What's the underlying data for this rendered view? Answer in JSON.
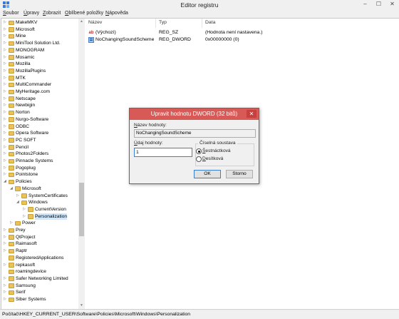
{
  "window": {
    "title": "Editor registru",
    "minimize": "–",
    "maximize": "☐",
    "close": "✕"
  },
  "menu": [
    {
      "accel": "S",
      "rest": "oubor"
    },
    {
      "accel": "Ú",
      "rest": "pravy"
    },
    {
      "accel": "Z",
      "rest": "obrazit"
    },
    {
      "accel": "O",
      "rest": "blíbené položky"
    },
    {
      "accel": "N",
      "rest": "ápověda"
    }
  ],
  "tree": [
    {
      "label": "MakeMKV",
      "level": 0,
      "expanded": false
    },
    {
      "label": "Microsoft",
      "level": 0,
      "expanded": false
    },
    {
      "label": "Mine",
      "level": 0,
      "expanded": false
    },
    {
      "label": "MiniTool Solution Ltd.",
      "level": 0,
      "expanded": false
    },
    {
      "label": "MONOGRAM",
      "level": 0,
      "expanded": false
    },
    {
      "label": "Mosamic",
      "level": 0,
      "expanded": false
    },
    {
      "label": "Mozilla",
      "level": 0,
      "expanded": false
    },
    {
      "label": "MozillaPlugins",
      "level": 0,
      "expanded": false
    },
    {
      "label": "MTK",
      "level": 0,
      "expanded": false
    },
    {
      "label": "MultiCommander",
      "level": 0,
      "expanded": false
    },
    {
      "label": "MyHeritage.com",
      "level": 0,
      "expanded": false
    },
    {
      "label": "Netscape",
      "level": 0,
      "expanded": false
    },
    {
      "label": "Newbigin",
      "level": 0,
      "expanded": false
    },
    {
      "label": "Norton",
      "level": 0,
      "expanded": false
    },
    {
      "label": "Nurgo-Software",
      "level": 0,
      "expanded": false
    },
    {
      "label": "ODBC",
      "level": 0,
      "expanded": false
    },
    {
      "label": "Opera Software",
      "level": 0,
      "expanded": false
    },
    {
      "label": "PC SOFT",
      "level": 0,
      "expanded": false
    },
    {
      "label": "Pencil",
      "level": 0,
      "expanded": false
    },
    {
      "label": "Photos2Folders",
      "level": 0,
      "expanded": false
    },
    {
      "label": "Pinnacle Systems",
      "level": 0,
      "expanded": false
    },
    {
      "label": "Pogoplug",
      "level": 0,
      "expanded": false
    },
    {
      "label": "Pointstone",
      "level": 0,
      "expanded": false
    },
    {
      "label": "Policies",
      "level": 0,
      "expanded": true
    },
    {
      "label": "Microsoft",
      "level": 1,
      "expanded": true
    },
    {
      "label": "SystemCertificates",
      "level": 2,
      "expanded": false
    },
    {
      "label": "Windows",
      "level": 2,
      "expanded": true
    },
    {
      "label": "CurrentVersion",
      "level": 3,
      "expanded": false
    },
    {
      "label": "Personalization",
      "level": 3,
      "expanded": false,
      "selected": true
    },
    {
      "label": "Power",
      "level": 1,
      "expanded": false
    },
    {
      "label": "Prey",
      "level": 0,
      "expanded": false
    },
    {
      "label": "QtProject",
      "level": 0,
      "expanded": false
    },
    {
      "label": "Raimasoft",
      "level": 0,
      "expanded": false
    },
    {
      "label": "Raptr",
      "level": 0,
      "expanded": false
    },
    {
      "label": "RegisteredApplications",
      "level": 0,
      "expanded": false,
      "leaf": true
    },
    {
      "label": "repkasoft",
      "level": 0,
      "expanded": false
    },
    {
      "label": "roamingdevice",
      "level": 0,
      "expanded": false,
      "leaf": true
    },
    {
      "label": "Safer Networking Limited",
      "level": 0,
      "expanded": false
    },
    {
      "label": "Samsung",
      "level": 0,
      "expanded": false
    },
    {
      "label": "Serif",
      "level": 0,
      "expanded": false
    },
    {
      "label": "Siber Systems",
      "level": 0,
      "expanded": false
    }
  ],
  "list": {
    "headers": {
      "name": "Název",
      "type": "Typ",
      "data": "Data"
    },
    "rows": [
      {
        "icon": "string-value-icon",
        "name": "(Výchozí)",
        "type": "REG_SZ",
        "data": "(Hodnota není nastavena.)"
      },
      {
        "icon": "dword-value-icon",
        "name": "NoChangingSoundScheme",
        "type": "REG_DWORD",
        "data": "0x00000000 (0)"
      }
    ]
  },
  "status": "Počítač\\HKEY_CURRENT_USER\\Software\\Policies\\Microsoft\\Windows\\Personalization",
  "dialog": {
    "title": "Upravit hodnotu DWORD (32 bitů)",
    "close": "✕",
    "name_label_accel": "N",
    "name_label_rest": "ázev hodnoty:",
    "name_value": "NoChangingSoundScheme",
    "data_label_accel": "Ú",
    "data_label_rest": "daj hodnoty:",
    "data_value": "1",
    "base_label": "Číselná soustava",
    "radio_hex_accel": "Š",
    "radio_hex_rest": "estnáctková",
    "radio_dec_accel": "D",
    "radio_dec_rest": "esítková",
    "selected_base": "hex",
    "ok": "OK",
    "cancel": "Storno"
  }
}
